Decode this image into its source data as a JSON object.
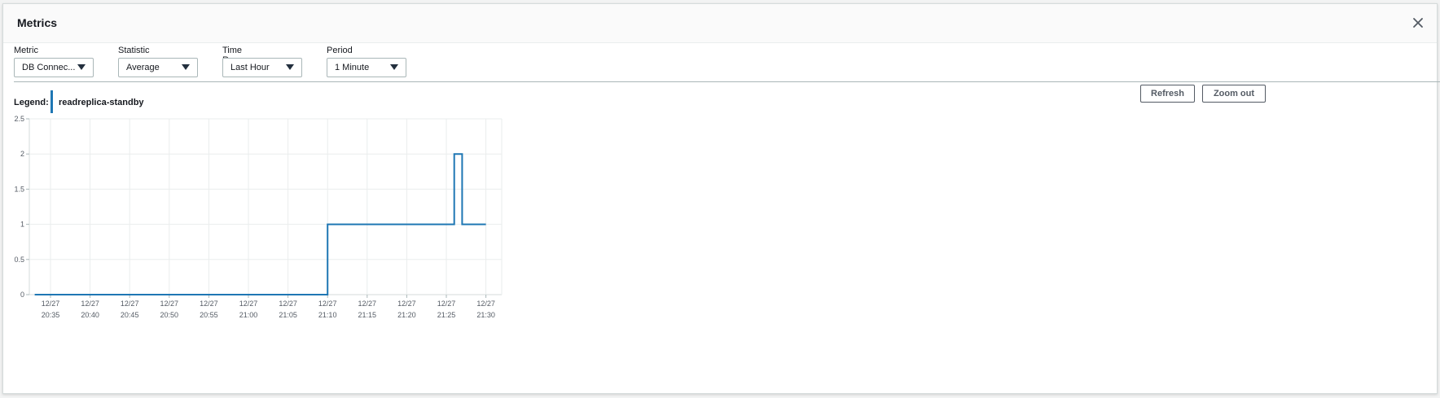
{
  "modal": {
    "title": "Metrics"
  },
  "controls": {
    "metric": {
      "label": "Metric",
      "value": "DB Connec..."
    },
    "statistic": {
      "label": "Statistic",
      "value": "Average"
    },
    "time_range": {
      "label": "Time Range",
      "value": "Last Hour"
    },
    "period": {
      "label": "Period",
      "value": "1 Minute"
    }
  },
  "buttons": {
    "refresh": "Refresh",
    "zoom_out": "Zoom out"
  },
  "legend": {
    "label": "Legend:",
    "series_name": "readreplica-standby",
    "color": "#1f77b4"
  },
  "chart_data": {
    "type": "line",
    "step": true,
    "ylim": [
      0,
      2.5
    ],
    "yticks": [
      "0",
      "0.5",
      "1",
      "1.5",
      "2",
      "2.5"
    ],
    "xticks": [
      [
        "12/27",
        "20:35"
      ],
      [
        "12/27",
        "20:40"
      ],
      [
        "12/27",
        "20:45"
      ],
      [
        "12/27",
        "20:50"
      ],
      [
        "12/27",
        "20:55"
      ],
      [
        "12/27",
        "21:00"
      ],
      [
        "12/27",
        "21:05"
      ],
      [
        "12/27",
        "21:10"
      ],
      [
        "12/27",
        "21:15"
      ],
      [
        "12/27",
        "21:20"
      ],
      [
        "12/27",
        "21:25"
      ],
      [
        "12/27",
        "21:30"
      ]
    ],
    "grid": true,
    "series": [
      {
        "name": "readreplica-standby",
        "color": "#1f77b4",
        "points": [
          [
            "20:33",
            0
          ],
          [
            "21:10",
            0
          ],
          [
            "21:10",
            1
          ],
          [
            "21:26",
            1
          ],
          [
            "21:26",
            2
          ],
          [
            "21:27",
            2
          ],
          [
            "21:27",
            1
          ],
          [
            "21:30",
            1
          ]
        ]
      }
    ]
  }
}
